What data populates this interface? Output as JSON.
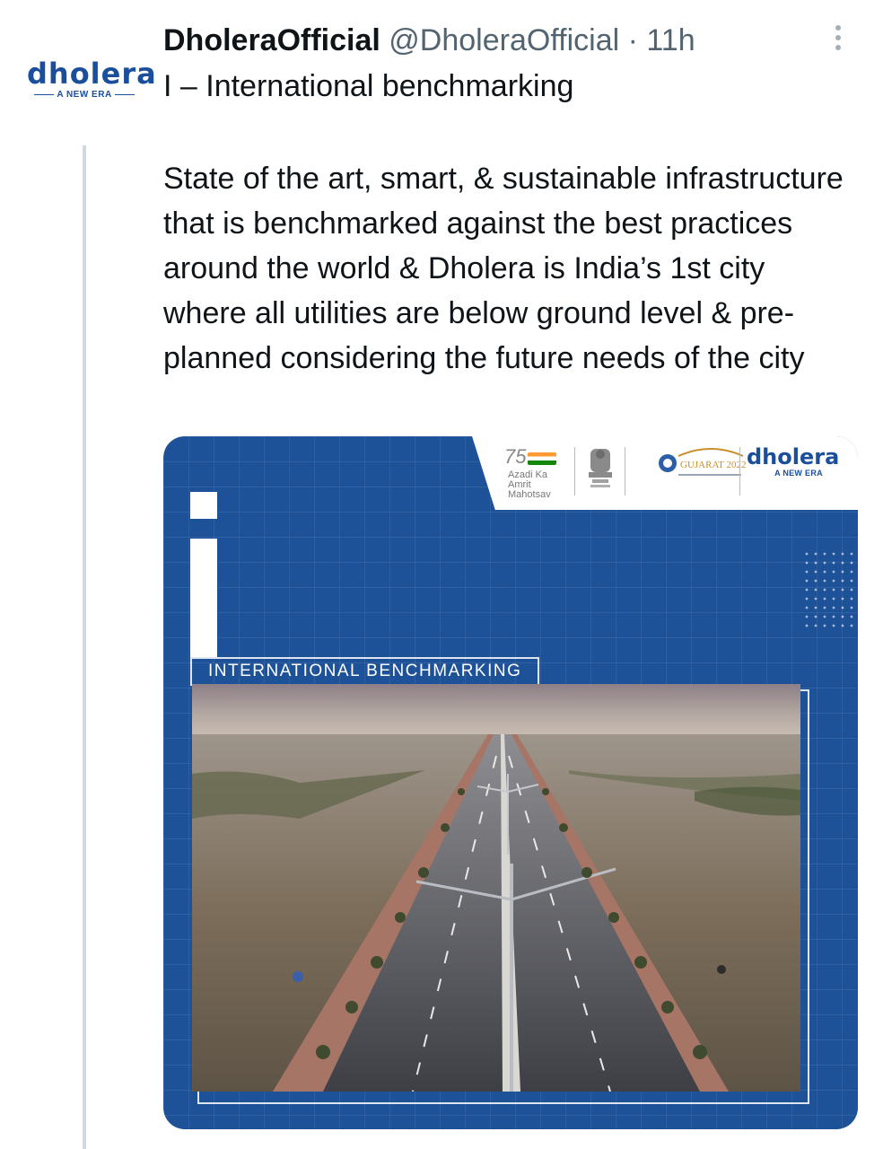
{
  "tweet": {
    "author_name": "DholeraOfficial",
    "handle": "@DholeraOfficial",
    "separator": "·",
    "time": "11h",
    "first_line": "I – International benchmarking",
    "body": "State of the art, smart, & sustainable infrastructure that is benchmarked against the best practices around the world & Dholera is India’s 1st city where all utilities are below ground level & pre-planned considering the future needs of the city"
  },
  "avatar": {
    "wordmark": "dholera",
    "tagline": "A NEW ERA"
  },
  "media": {
    "card_label": "INTERNATIONAL BENCHMARKING",
    "logos": {
      "azadi_number": "75",
      "azadi_text": "Azadi Ka Amrit Mahotsav",
      "gujarat_text": "GUJARAT 2022",
      "dholera_wordmark": "dholera",
      "dholera_tagline": "A NEW ERA"
    },
    "photo_subject": "aerial view of divided highway with street lights",
    "colors": {
      "card_blue": "#1d5198",
      "brand_blue": "#1b4f9c"
    }
  }
}
